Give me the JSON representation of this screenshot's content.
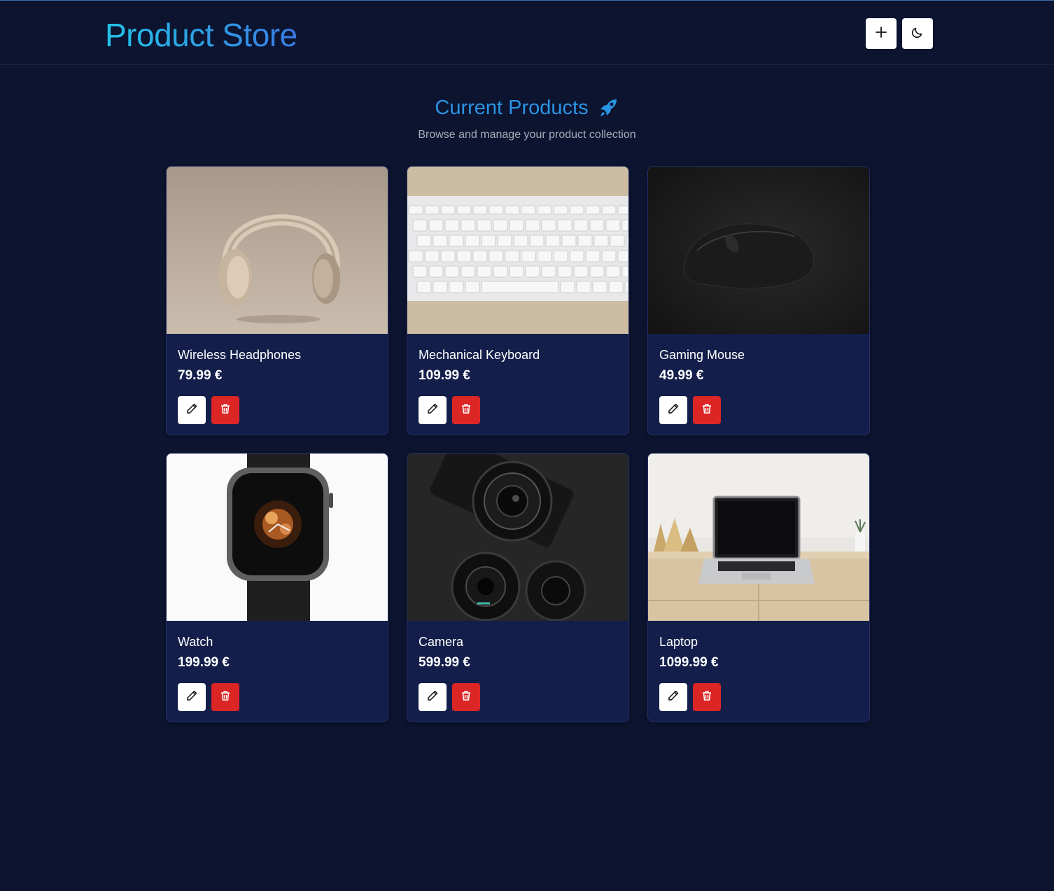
{
  "app": {
    "brand": "Product Store"
  },
  "header": {
    "add_icon": "plus-icon",
    "theme_icon": "moon-icon"
  },
  "main": {
    "title": "Current Products",
    "title_icon": "rocket-icon",
    "subtitle": "Browse and manage your product collection"
  },
  "colors": {
    "background": "#0c1430",
    "card": "#131e4b",
    "accent": "#2a94e4",
    "delete": "#dc2626"
  },
  "products": [
    {
      "name": "Wireless Headphones",
      "price": "79.99 €",
      "image": "headphones-image"
    },
    {
      "name": "Mechanical Keyboard",
      "price": "109.99 €",
      "image": "keyboard-image"
    },
    {
      "name": "Gaming Mouse",
      "price": "49.99 €",
      "image": "mouse-image"
    },
    {
      "name": "Watch",
      "price": "199.99 €",
      "image": "watch-image"
    },
    {
      "name": "Camera",
      "price": "599.99 €",
      "image": "camera-image"
    },
    {
      "name": "Laptop",
      "price": "1099.99 €",
      "image": "laptop-image"
    }
  ]
}
